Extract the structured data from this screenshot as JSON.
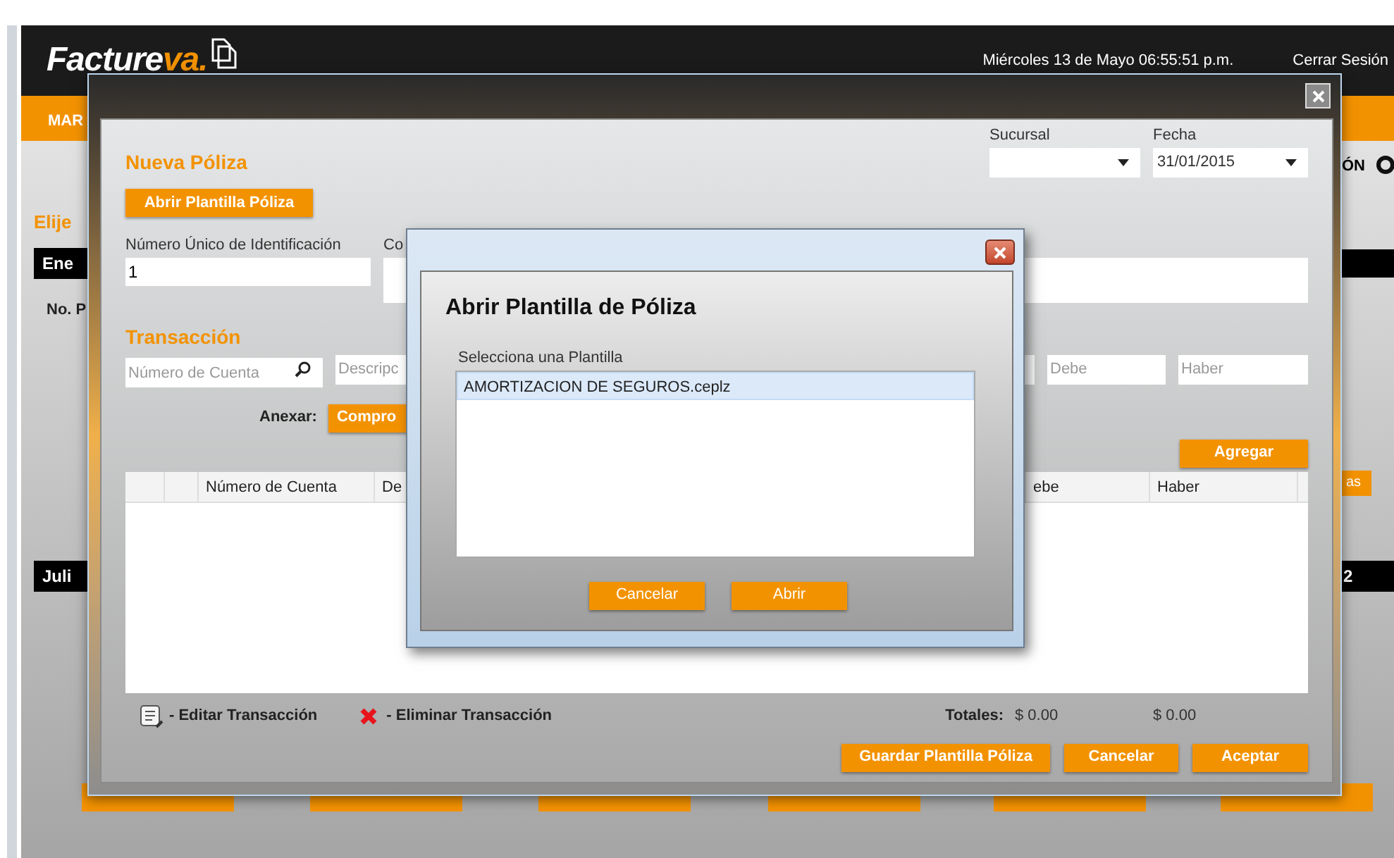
{
  "header": {
    "logo_start": "Facture",
    "logo_end": "va.",
    "datetime": "Miércoles 13 de Mayo 06:55:51 p.m.",
    "sign_out": "Cerrar Sesión"
  },
  "nav": {
    "item": "MAR"
  },
  "background": {
    "heading": "Elije",
    "month_bars": [
      {
        "label": "Ene"
      },
      {
        "label": "Juli"
      }
    ],
    "column_label": "No. P",
    "right_header": "ÓN",
    "right_bar": "2",
    "right_button": "as"
  },
  "poliza": {
    "title": "Nueva Póliza",
    "open_template_button": "Abrir Plantilla Póliza",
    "sucursal": {
      "label": "Sucursal"
    },
    "fecha": {
      "label": "Fecha",
      "value": "31/01/2015"
    },
    "id_field": {
      "label": "Número Único de Identificación",
      "value": "1"
    },
    "concept_label": "Co",
    "section": "Transacción",
    "account_field": {
      "placeholder": "Número de Cuenta"
    },
    "description_field": {
      "placeholder": "Descripc"
    },
    "debe_field": {
      "placeholder": "Debe"
    },
    "haber_field": {
      "placeholder": "Haber"
    },
    "attach_label": "Anexar:",
    "attach_button": "Compro",
    "add_button": "Agregar",
    "table": {
      "columns": [
        "Número de Cuenta",
        "De",
        "ebe",
        "Haber"
      ]
    },
    "edit_legend": "- Editar Transacción",
    "delete_legend": "- Eliminar Transacción",
    "totals_label": "Totales:",
    "total_debe": "$ 0.00",
    "total_haber": "$ 0.00",
    "buttons": [
      "Guardar Plantilla Póliza",
      "Cancelar",
      "Aceptar"
    ]
  },
  "dialog": {
    "heading": "Abrir Plantilla de Póliza",
    "list_label": "Selecciona una Plantilla",
    "items": [
      {
        "label": "AMORTIZACION DE SEGUROS.ceplz",
        "selected": true
      }
    ],
    "buttons": [
      "Cancelar",
      "Abrir"
    ]
  }
}
